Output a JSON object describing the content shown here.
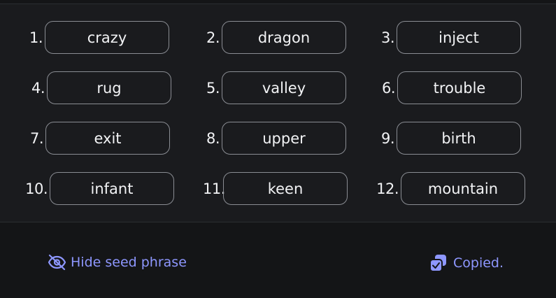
{
  "seed": {
    "words": [
      {
        "index": "1.",
        "word": "crazy"
      },
      {
        "index": "2.",
        "word": "dragon"
      },
      {
        "index": "3.",
        "word": "inject"
      },
      {
        "index": "4.",
        "word": "rug"
      },
      {
        "index": "5.",
        "word": "valley"
      },
      {
        "index": "6.",
        "word": "trouble"
      },
      {
        "index": "7.",
        "word": "exit"
      },
      {
        "index": "8.",
        "word": "upper"
      },
      {
        "index": "9.",
        "word": "birth"
      },
      {
        "index": "10.",
        "word": "infant"
      },
      {
        "index": "11.",
        "word": "keen"
      },
      {
        "index": "12.",
        "word": "mountain"
      }
    ]
  },
  "actions": {
    "hide_label": "Hide seed phrase",
    "hide_icon": "eye-off-icon",
    "copy_label": "Copied.",
    "copy_icon": "copy-icon"
  },
  "colors": {
    "background": "#141517",
    "panel": "#1a1b1e",
    "accent": "#8e97ff",
    "pill_border": "#8a8d93"
  }
}
